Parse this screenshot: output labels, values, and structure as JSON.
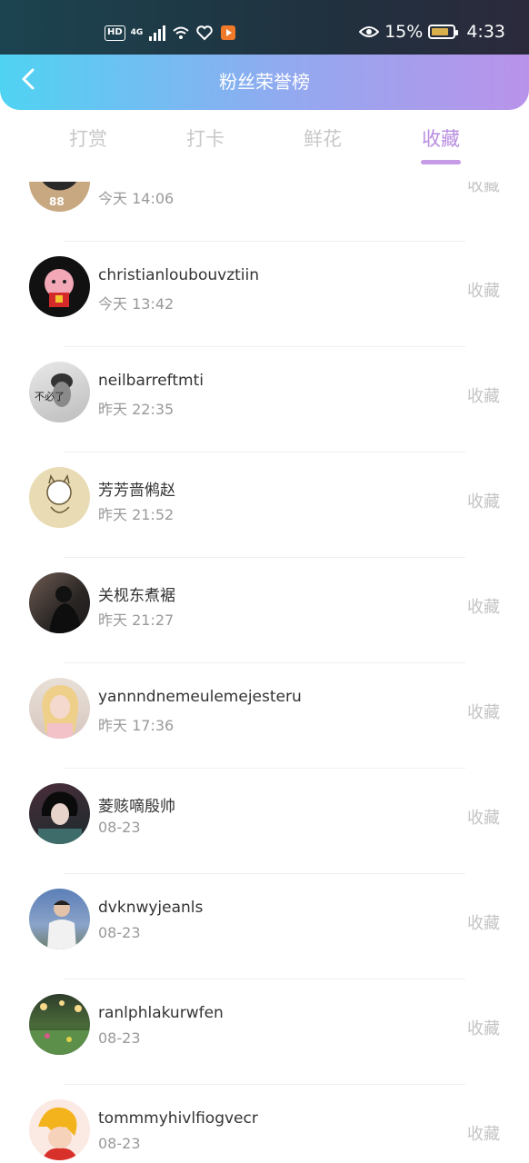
{
  "status_bar": {
    "hd": "HD",
    "network": "4G",
    "battery_percent": "15%",
    "time": "4:33"
  },
  "header": {
    "title": "粉丝荣誉榜"
  },
  "tabs": [
    {
      "label": "打赏"
    },
    {
      "label": "打卡"
    },
    {
      "label": "鲜花"
    },
    {
      "label": "收藏"
    }
  ],
  "active_tab": "收藏",
  "list": [
    {
      "name": "",
      "time": "今天 14:06",
      "action": "收藏",
      "avatar": "jersey-88"
    },
    {
      "name": "christianloubouvztiin",
      "time": "今天 13:42",
      "action": "收藏",
      "avatar": "cartoon-pig"
    },
    {
      "name": "neilbarreftmti",
      "time": "昨天 22:35",
      "action": "收藏",
      "avatar": "bw-person"
    },
    {
      "name": "芳芳啬鸺赵",
      "time": "昨天 21:52",
      "action": "收藏",
      "avatar": "cartoon-cat"
    },
    {
      "name": "关枧东煮裾",
      "time": "昨天 21:27",
      "action": "收藏",
      "avatar": "dark-silhouette"
    },
    {
      "name": "yannndnemeulemejesteru",
      "time": "昨天 17:36",
      "action": "收藏",
      "avatar": "blonde-woman"
    },
    {
      "name": "菱赅嘀殷帅",
      "time": "08-23",
      "action": "收藏",
      "avatar": "dark-portrait"
    },
    {
      "name": "dvknwyjeanls",
      "time": "08-23",
      "action": "收藏",
      "avatar": "man-outdoors"
    },
    {
      "name": "ranlphlakurwfen",
      "time": "08-23",
      "action": "收藏",
      "avatar": "garden-night"
    },
    {
      "name": "tommmyhivlfiogvecr",
      "time": "08-23",
      "action": "收藏",
      "avatar": "cartoon-character"
    }
  ]
}
